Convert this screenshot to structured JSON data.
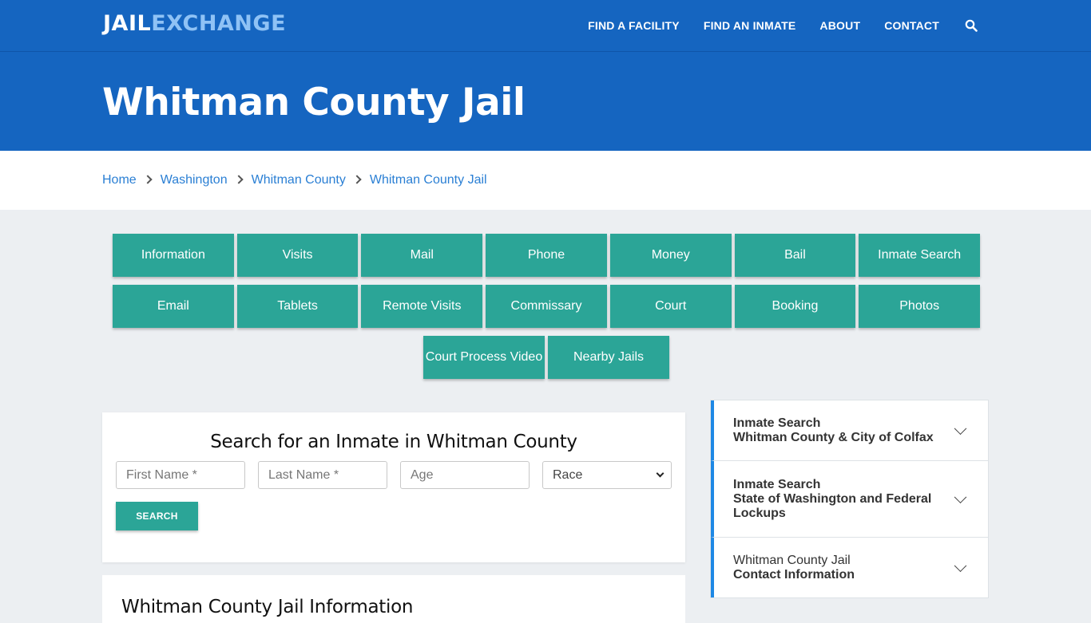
{
  "header": {
    "logo_part1": "JAIL",
    "logo_part2": "EXCHANGE",
    "nav": [
      "FIND A FACILITY",
      "FIND AN INMATE",
      "ABOUT",
      "CONTACT"
    ],
    "search_icon": "search-icon"
  },
  "hero": {
    "title": "Whitman County Jail"
  },
  "breadcrumb": [
    "Home",
    "Washington",
    "Whitman County",
    "Whitman County Jail"
  ],
  "tiles": {
    "row1": [
      "Information",
      "Visits",
      "Mail",
      "Phone",
      "Money",
      "Bail",
      "Inmate Search"
    ],
    "row2": [
      "Email",
      "Tablets",
      "Remote Visits",
      "Commissary",
      "Court",
      "Booking",
      "Photos"
    ],
    "row3": [
      "Court Process Video",
      "Nearby Jails"
    ]
  },
  "search_form": {
    "title": "Search for an Inmate in Whitman County",
    "first_name_placeholder": "First Name *",
    "last_name_placeholder": "Last Name *",
    "age_placeholder": "Age",
    "race_selected": "Race",
    "button_label": "SEARCH"
  },
  "info_section": {
    "title": "Whitman County Jail Information"
  },
  "sidebar": [
    {
      "line1": "Inmate Search",
      "line2": "Whitman County & City of Colfax",
      "line1_bold": true
    },
    {
      "line1": "Inmate Search",
      "line2": "State of Washington and Federal Lockups",
      "line1_bold": true
    },
    {
      "line1": "Whitman County Jail",
      "line2": "Contact Information",
      "line1_bold": false
    }
  ],
  "colors": {
    "brand_blue": "#1565c0",
    "teal": "#2ba597",
    "accent_blue": "#1e88e5",
    "link": "#2a7fd4"
  }
}
